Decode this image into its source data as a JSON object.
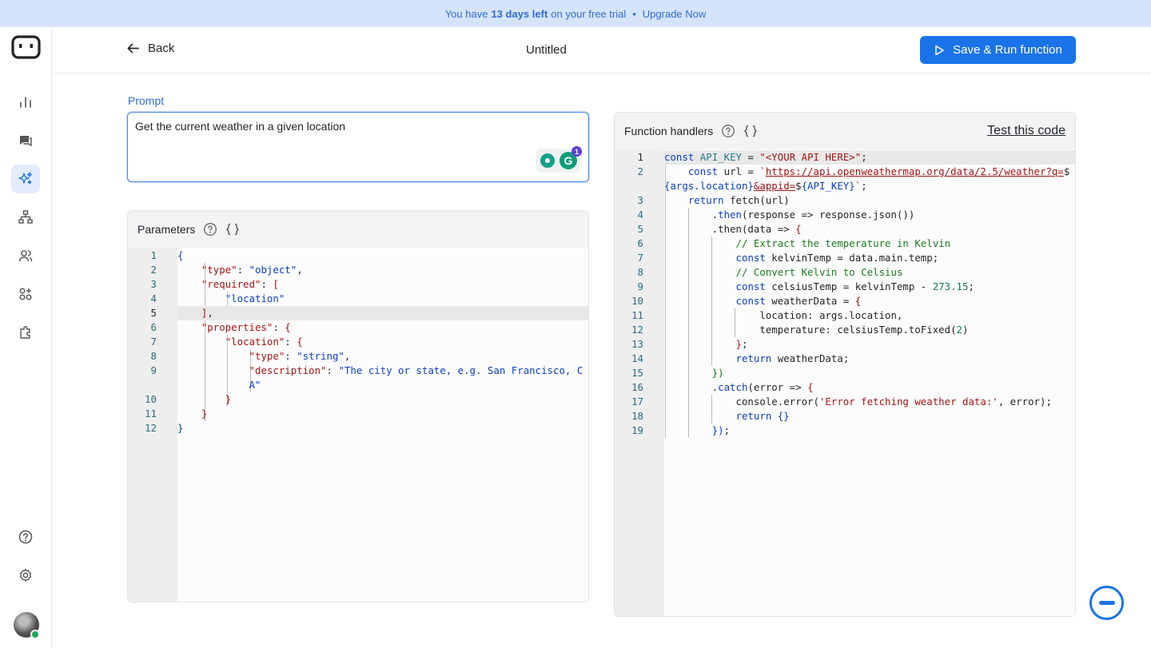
{
  "banner": {
    "prefix": "You have",
    "highlight": "13 days left",
    "suffix": "on your free trial",
    "separator": "•",
    "upgrade": "Upgrade Now"
  },
  "sidebar": {
    "items": [
      {
        "icon": "chart-bar-icon",
        "active": false
      },
      {
        "icon": "chat-icon",
        "active": false
      },
      {
        "icon": "sparkles-icon",
        "active": true
      },
      {
        "icon": "sitemap-icon",
        "active": false
      },
      {
        "icon": "users-icon",
        "active": false
      },
      {
        "icon": "apps-add-icon",
        "active": false
      },
      {
        "icon": "puzzle-icon",
        "active": false
      }
    ],
    "bottom": [
      {
        "icon": "help-icon"
      },
      {
        "icon": "settings-icon"
      }
    ]
  },
  "topbar": {
    "back_label": "Back",
    "title": "Untitled",
    "run_label": "Save & Run function"
  },
  "prompt": {
    "label": "Prompt",
    "value": "Get the current weather in a given location"
  },
  "parameters": {
    "title": "Parameters",
    "line_numbers": [
      "1",
      "2",
      "3",
      "4",
      "5",
      "6",
      "7",
      "8",
      "9",
      "",
      "10",
      "11",
      "12"
    ]
  },
  "function_handlers": {
    "title": "Function handlers",
    "test_label": "Test this code",
    "line_numbers": [
      "1",
      "2",
      "",
      "3",
      "4",
      "5",
      "6",
      "7",
      "8",
      "9",
      "10",
      "11",
      "12",
      "13",
      "14",
      "15",
      "16",
      "17",
      "18",
      "19"
    ]
  },
  "colors": {
    "accent": "#1a73e8",
    "banner_bg": "#d6e4fb",
    "sidebar_active": "#e4ecfb"
  }
}
